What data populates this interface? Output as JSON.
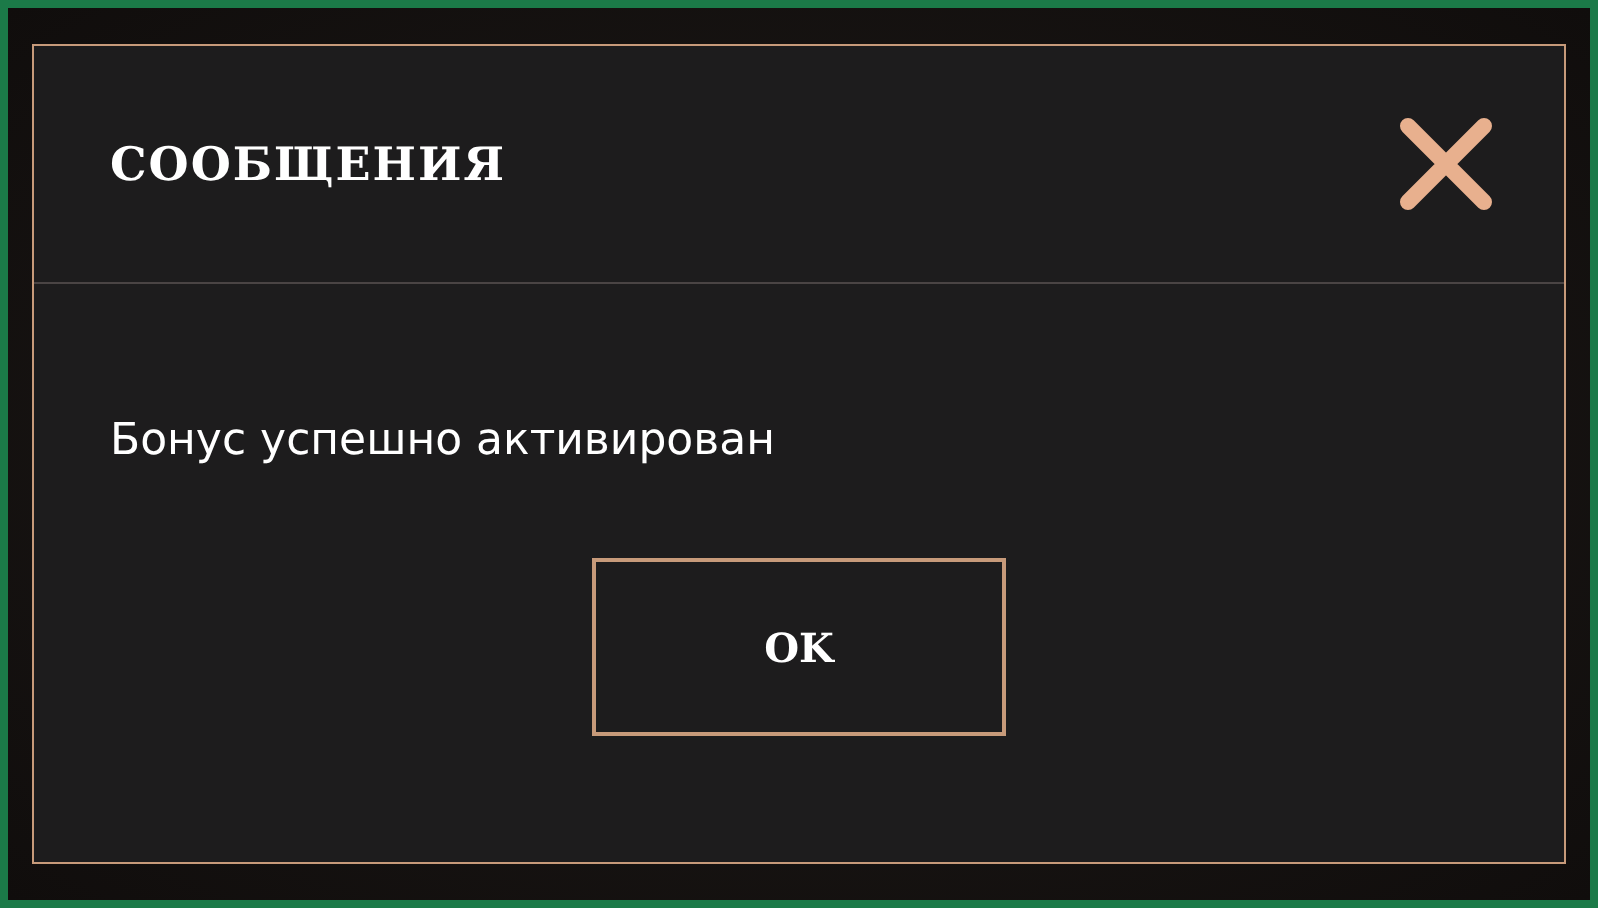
{
  "dialog": {
    "title": "СООБЩЕНИЯ",
    "message": "Бонус успешно активирован",
    "buttons": [
      "OK"
    ]
  }
}
